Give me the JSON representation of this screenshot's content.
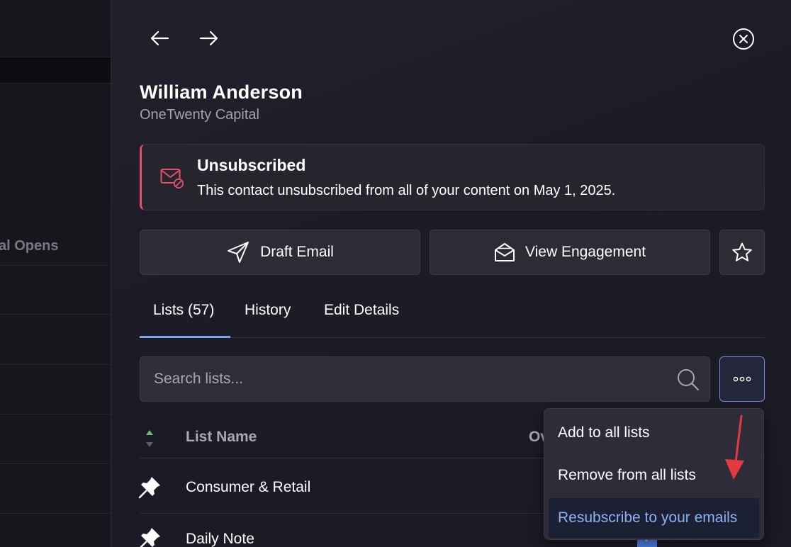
{
  "background": {
    "column_header_partial": "al Opens"
  },
  "contact": {
    "name": "William Anderson",
    "company": "OneTwenty Capital"
  },
  "alert": {
    "title": "Unsubscribed",
    "message": "This contact unsubscribed from all of your content on May 1, 2025.",
    "icon": "mail-blocked-icon",
    "color": "#e0506a"
  },
  "actions": {
    "draft_email": "Draft Email",
    "view_engagement": "View Engagement"
  },
  "tabs": [
    {
      "label": "Lists (57)",
      "active": true
    },
    {
      "label": "History",
      "active": false
    },
    {
      "label": "Edit Details",
      "active": false
    }
  ],
  "search": {
    "placeholder": "Search lists...",
    "value": ""
  },
  "table": {
    "headers": {
      "list_name": "List Name",
      "owner_partial": "Ov"
    },
    "rows": [
      {
        "name": "Consumer & Retail",
        "pinned": true
      },
      {
        "name": "Daily Note",
        "pinned": true
      }
    ]
  },
  "menu": {
    "items": [
      {
        "label": "Add to all lists",
        "highlighted": false
      },
      {
        "label": "Remove from all lists",
        "highlighted": false
      },
      {
        "label": "Resubscribe to your emails",
        "highlighted": true
      }
    ]
  },
  "colors": {
    "accent": "#7aa2ea",
    "danger": "#e0506a",
    "annotation_arrow": "#e5393f"
  }
}
